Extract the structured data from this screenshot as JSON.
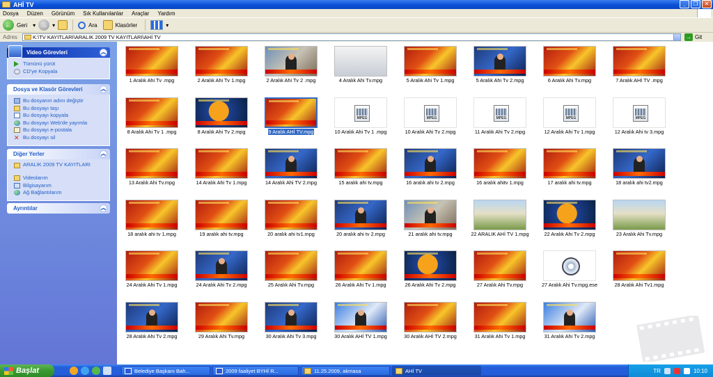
{
  "window": {
    "title": "AHİ TV"
  },
  "menu": [
    "Dosya",
    "Düzen",
    "Görünüm",
    "Sık Kullanılanlar",
    "Araçlar",
    "Yardım"
  ],
  "toolbar": {
    "back": "Geri",
    "search": "Ara",
    "folders": "Klasörler"
  },
  "address": {
    "label": "Adres",
    "path": "K:\\TV KAYITLARI\\ARALIK 2009 TV KAYITLARI\\AHİ TV",
    "go": "Git"
  },
  "sidebar": {
    "video_tasks": {
      "title": "Video Görevleri",
      "items": [
        "Tümünü yürüt",
        "CD'ye Kopyala"
      ]
    },
    "file_tasks": {
      "title": "Dosya ve Klasör Görevleri",
      "items": [
        "Bu dosyanın adını değiştir",
        "Bu dosyayı taşı",
        "Bu dosyayı kopyala",
        "Bu dosyayı Web'de yayımla",
        "Bu dosyayı e-postala",
        "Bu dosyayı sil"
      ]
    },
    "other_places": {
      "title": "Diğer Yerler",
      "items": [
        "ARALIK 2009 TV KAYITLARI",
        "Videolarım",
        "Bilgisayarım",
        "Ağ Bağlantılarım"
      ]
    },
    "details": {
      "title": "Ayrıntılar"
    }
  },
  "files": [
    {
      "name": "1 Aralık Ahi Tv .mpg",
      "kind": "thumb",
      "variant": "news"
    },
    {
      "name": "2 Aralık Ahi Tv 1.mpg",
      "kind": "thumb",
      "variant": "news"
    },
    {
      "name": "2 Aralık Ahi Tv 2 .mpg",
      "kind": "thumb",
      "variant": "people"
    },
    {
      "name": "4 Aralık Ahi Tv.mpg",
      "kind": "thumb",
      "variant": "meeting"
    },
    {
      "name": "5 Aralık Ahi Tv 1.mpg",
      "kind": "thumb",
      "variant": "news"
    },
    {
      "name": "5 Aralık Ahi Tv 2.mpg",
      "kind": "thumb",
      "variant": "anchor"
    },
    {
      "name": "6 Aralık Ahi Tv.mpg",
      "kind": "thumb",
      "variant": "news"
    },
    {
      "name": "7 Aralık AHİ TV .mpg",
      "kind": "thumb",
      "variant": "news"
    },
    {
      "name": "8 Aralık Ahi Tv 1 .mpg",
      "kind": "thumb",
      "variant": "news"
    },
    {
      "name": "8 Aralık Ahi Tv 2.mpg",
      "kind": "thumb",
      "variant": "globe"
    },
    {
      "name": "9 Aralık AHİ TV.mpg",
      "kind": "thumb",
      "variant": "news",
      "selected": true
    },
    {
      "name": "10 Aralık Ahi Tv 1 .mpg",
      "kind": "mpeg"
    },
    {
      "name": "10 Aralık Ahi Tv 2.mpg",
      "kind": "mpeg"
    },
    {
      "name": "11 Aralık Ahi Tv 2.mpg",
      "kind": "mpeg"
    },
    {
      "name": "12 Aralık Ahi Tv 1.mpg",
      "kind": "mpeg"
    },
    {
      "name": "12 Aralık Ahi tv 3.mpg",
      "kind": "mpeg"
    },
    {
      "name": "13 Aralık Ahi Tv.mpg",
      "kind": "thumb",
      "variant": "news"
    },
    {
      "name": "14 Aralık Ahi Tv 1.mpg",
      "kind": "thumb",
      "variant": "news"
    },
    {
      "name": "14 Aralık Ahi TV 2.mpg",
      "kind": "thumb",
      "variant": "anchor"
    },
    {
      "name": "15 aralık ahi tv.mpg",
      "kind": "thumb",
      "variant": "news"
    },
    {
      "name": "16 aralık ahi tv 2.mpg",
      "kind": "thumb",
      "variant": "anchor"
    },
    {
      "name": "16 aralık ahitv 1.mpg",
      "kind": "thumb",
      "variant": "news"
    },
    {
      "name": "17 aralık ahi tv.mpg",
      "kind": "thumb",
      "variant": "news"
    },
    {
      "name": "18 aralık ahi tv2.mpg",
      "kind": "thumb",
      "variant": "anchor"
    },
    {
      "name": "18 aralık ahi tv 1.mpg",
      "kind": "thumb",
      "variant": "news"
    },
    {
      "name": "19 aralık ahi tv.mpg",
      "kind": "thumb",
      "variant": "news"
    },
    {
      "name": "20 aralık ahi tv1.mpg",
      "kind": "thumb",
      "variant": "news"
    },
    {
      "name": "20 aralık ahi tv 2.mpg",
      "kind": "thumb",
      "variant": "anchor"
    },
    {
      "name": "21 aralık ahi tv.mpg",
      "kind": "thumb",
      "variant": "people"
    },
    {
      "name": "22 ARALIK AHİ TV 1.mpg",
      "kind": "thumb",
      "variant": "outdoor"
    },
    {
      "name": "22 Aralık Ahi Tv 2.mpg",
      "kind": "thumb",
      "variant": "globe"
    },
    {
      "name": "23 Aralık Ahi Tv.mpg",
      "kind": "thumb",
      "variant": "outdoor"
    },
    {
      "name": "24 Aralık Ahi Tv 1.mpg",
      "kind": "thumb",
      "variant": "news"
    },
    {
      "name": "24 Aralık Ahi Tv 2.mpg",
      "kind": "thumb",
      "variant": "anchor"
    },
    {
      "name": "25 Aralık Ahi Tv.mpg",
      "kind": "thumb",
      "variant": "news"
    },
    {
      "name": "26 Aralık Ahi Tv 1.mpg",
      "kind": "thumb",
      "variant": "news"
    },
    {
      "name": "26 Aralık Ahi Tv 2.mpg",
      "kind": "thumb",
      "variant": "globe"
    },
    {
      "name": "27 Aralık Ahi Tv.mpg",
      "kind": "thumb",
      "variant": "news"
    },
    {
      "name": "27 Aralık Ahi Tv.mpg.ese",
      "kind": "reel"
    },
    {
      "name": "28 Aralık Ahi Tv1.mpg",
      "kind": "thumb",
      "variant": "news"
    },
    {
      "name": "28 Aralık Ahi Tv 2.mpg",
      "kind": "thumb",
      "variant": "anchor"
    },
    {
      "name": "29 Aralık Ahi Tv.mpg",
      "kind": "thumb",
      "variant": "news"
    },
    {
      "name": "30 Aralık Ahi Tv 3.mpg",
      "kind": "thumb",
      "variant": "anchor"
    },
    {
      "name": "30 Aralık AHİ TV 1.mpg",
      "kind": "thumb",
      "variant": "interview"
    },
    {
      "name": "30 Aralık AHİ TV 2.mpg",
      "kind": "thumb",
      "variant": "news"
    },
    {
      "name": "31 Aralık Ahi Tv 1.mpg",
      "kind": "thumb",
      "variant": "news"
    },
    {
      "name": "31 Aralık Ahi Tv 2.mpg",
      "kind": "thumb",
      "variant": "interview"
    }
  ],
  "taskbar": {
    "start": "Başlat",
    "tasks": [
      "Belediye Başkanı Bah...",
      "2009 faaliyet BYHİ R...",
      "11.25.2009, akmasa",
      "AHİ TV"
    ],
    "active_index": 3,
    "locale": "TR",
    "clock": "10:10"
  },
  "colors": {
    "titlebar": "#0a50d8",
    "sidebar": "#6f8fdf",
    "selection": "#316ac5",
    "taskbar": "#245edb",
    "start": "#3a9a31"
  }
}
